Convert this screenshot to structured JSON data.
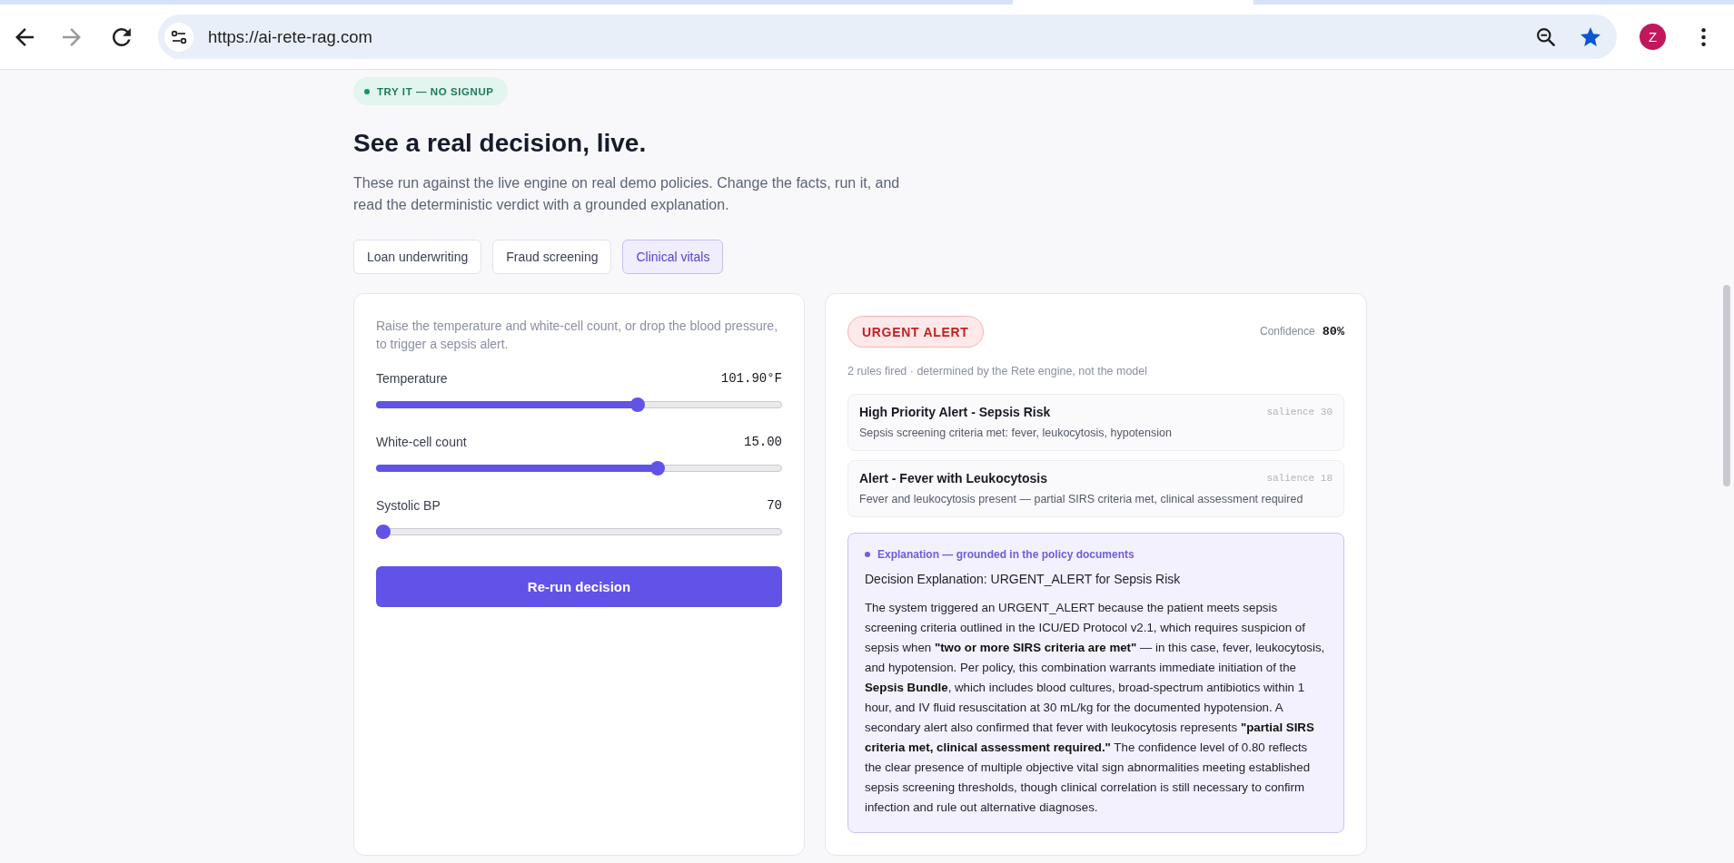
{
  "browser": {
    "url": "https://ai-rete-rag.com",
    "profile_initial": "Z",
    "forward_disabled": true
  },
  "hero": {
    "badge": "TRY IT — NO SIGNUP",
    "title": "See a real decision, live.",
    "subtitle": "These run against the live engine on real demo policies. Change the facts, run it, and read the deterministic verdict with a grounded explanation."
  },
  "tabs": [
    {
      "label": "Loan underwriting",
      "selected": false
    },
    {
      "label": "Fraud screening",
      "selected": false
    },
    {
      "label": "Clinical vitals",
      "selected": true
    }
  ],
  "inputs": {
    "hint": "Raise the temperature and white-cell count, or drop the blood pressure, to trigger a sepsis alert.",
    "sliders": [
      {
        "label": "Temperature",
        "reading": "101.90°F",
        "level": 0.65
      },
      {
        "label": "White-cell count",
        "reading": "15.00",
        "level": 0.7
      },
      {
        "label": "Systolic BP",
        "reading": "70",
        "level": 0
      }
    ],
    "run_button": "Re-run decision"
  },
  "result": {
    "verdict": "URGENT ALERT",
    "confidence_label": "Confidence",
    "confidence": "80%",
    "summary": "2 rules fired · determined by the Rete engine, not the model",
    "rules": [
      {
        "title": "High Priority Alert - Sepsis Risk",
        "description": "Sepsis screening criteria met: fever, leukocytosis, hypotension",
        "salience": "salience 30"
      },
      {
        "title": "Alert - Fever with Leukocytosis",
        "description": "Fever and leukocytosis present — partial SIRS criteria met, clinical assessment required",
        "salience": "salience 18"
      }
    ],
    "explanation": {
      "header": "Explanation — grounded in the policy documents",
      "title": "Decision Explanation: URGENT_ALERT for Sepsis Risk",
      "body": "The system triggered an URGENT_ALERT because the patient meets sepsis screening criteria outlined in the ICU/ED Protocol v2.1, which requires suspicion of sepsis when **\"two or more SIRS criteria are met\"** — in this case, fever, leukocytosis, and hypotension. Per policy, this combination warrants immediate initiation of the **Sepsis Bundle**, which includes blood cultures, broad-spectrum antibiotics within 1 hour, and IV fluid resuscitation at 30 mL/kg for the documented hypotension. A secondary alert also confirmed that fever with leukocytosis represents **\"partial SIRS criteria met, clinical assessment required.\"** The confidence level of 0.80 reflects the clear presence of multiple objective vital sign abnormalities meeting established sepsis screening thresholds, though clinical correlation is still necessary to confirm infection and rule out alternative diagnoses."
    }
  }
}
